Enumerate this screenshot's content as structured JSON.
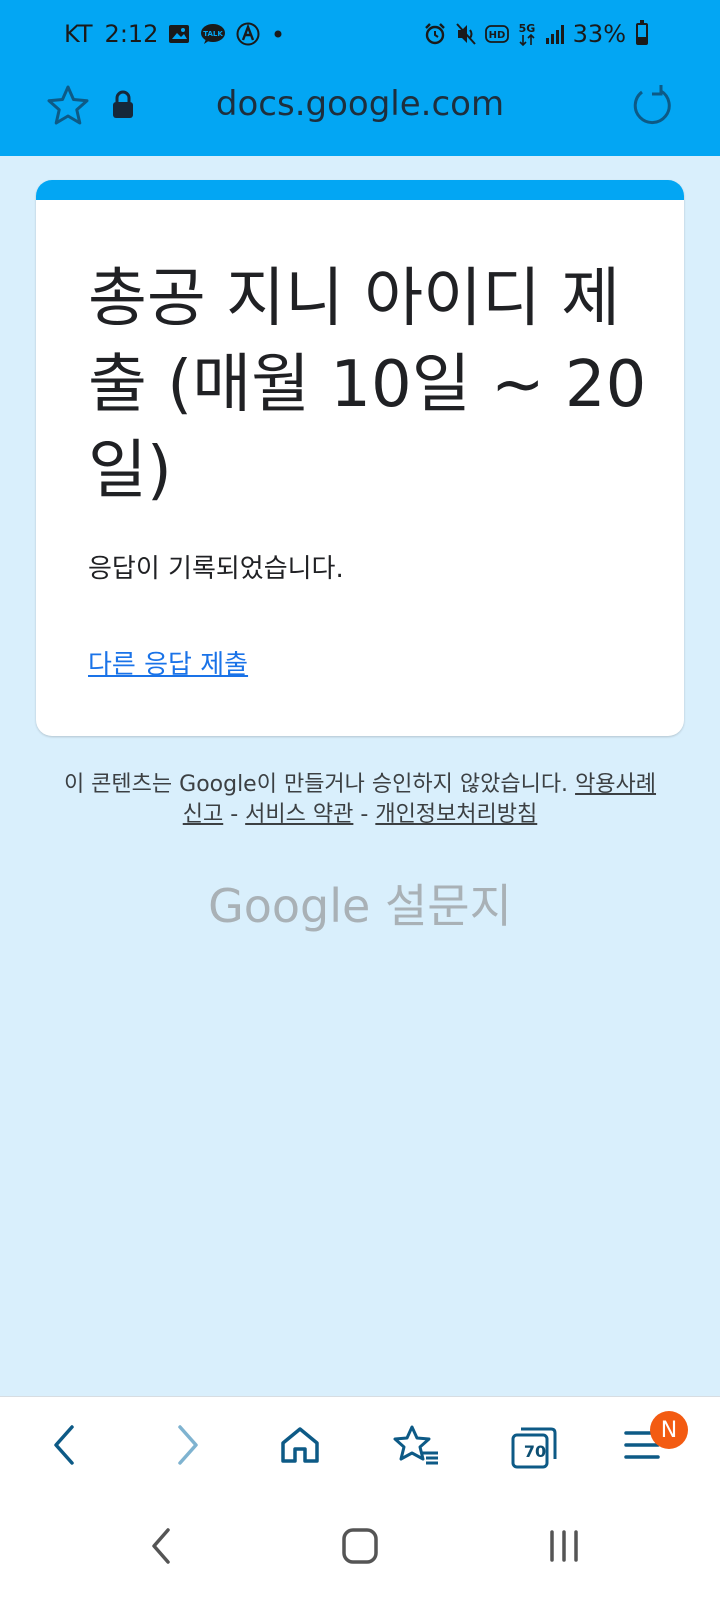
{
  "colors": {
    "accent": "#03a6f3",
    "background": "#d9effc",
    "link": "#1a73e8",
    "badge": "#f35b12"
  },
  "status_bar": {
    "carrier": "KT",
    "time": "2:12",
    "battery_percent": "33%",
    "battery_level": 0.33,
    "icons": [
      "gallery-icon",
      "talk-icon",
      "app-icon",
      "dot-icon",
      "alarm-icon",
      "mute-icon",
      "hd-icon",
      "5g-icon",
      "signal-icon",
      "battery-icon"
    ]
  },
  "browser": {
    "url": "docs.google.com",
    "icons": [
      "bookmark-star-icon",
      "lock-icon",
      "refresh-icon"
    ]
  },
  "form": {
    "title": "총공 지니 아이디 제출 (매월 10일 ~ 20일)",
    "confirmation": "응답이 기록되었습니다.",
    "another_response_link": "다른 응답 제출"
  },
  "footer": {
    "disclaimer_prefix": "이 콘텐츠는 Google이 만들거나 승인하지 않았습니다.",
    "report_abuse": "악용사례 신고",
    "separator": "-",
    "terms": "서비스 약관",
    "privacy": "개인정보처리방침",
    "brand_google": "Google",
    "brand_forms": "설문지"
  },
  "toolbar": {
    "tabs_count": "70",
    "menu_badge": "N",
    "icons": [
      "back-icon",
      "forward-icon",
      "home-icon",
      "bookmarks-icon",
      "tabs-icon",
      "menu-icon"
    ]
  },
  "system_nav": {
    "icons": [
      "nav-back-icon",
      "nav-home-icon",
      "nav-recents-icon"
    ]
  }
}
